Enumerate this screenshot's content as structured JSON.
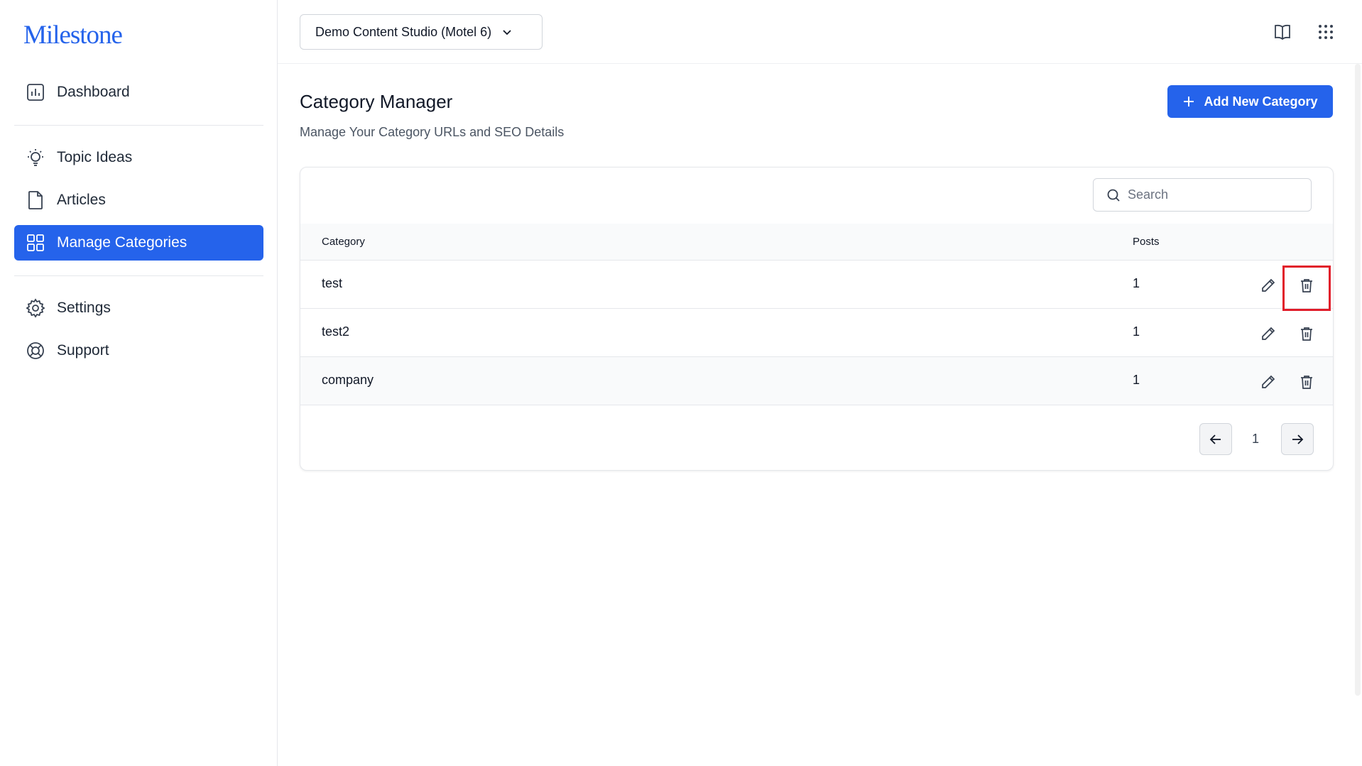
{
  "app": {
    "logo_text": "Milestone",
    "brand_color": "#2563eb"
  },
  "sidebar": {
    "items": [
      {
        "label": "Dashboard",
        "icon": "chart-icon",
        "active": false
      },
      {
        "label": "Topic Ideas",
        "icon": "lightbulb-icon",
        "active": false
      },
      {
        "label": "Articles",
        "icon": "document-icon",
        "active": false
      },
      {
        "label": "Manage Categories",
        "icon": "grid-icon",
        "active": true
      },
      {
        "label": "Settings",
        "icon": "gear-icon",
        "active": false
      },
      {
        "label": "Support",
        "icon": "lifebuoy-icon",
        "active": false
      }
    ]
  },
  "header": {
    "studio_select": "Demo Content Studio (Motel 6)",
    "icons": [
      "book-icon",
      "apps-grid-icon"
    ]
  },
  "main": {
    "title": "Category Manager",
    "subtitle": "Manage Your Category URLs and SEO Details",
    "add_button_label": "Add New Category",
    "search_placeholder": "Search",
    "table": {
      "columns": [
        "Category",
        "Posts"
      ],
      "rows": [
        {
          "category": "test",
          "posts": "1"
        },
        {
          "category": "test2",
          "posts": "1"
        },
        {
          "category": "company",
          "posts": "1"
        }
      ]
    },
    "pagination": {
      "current_page": "1"
    }
  },
  "highlight_color": "#e11d2a"
}
